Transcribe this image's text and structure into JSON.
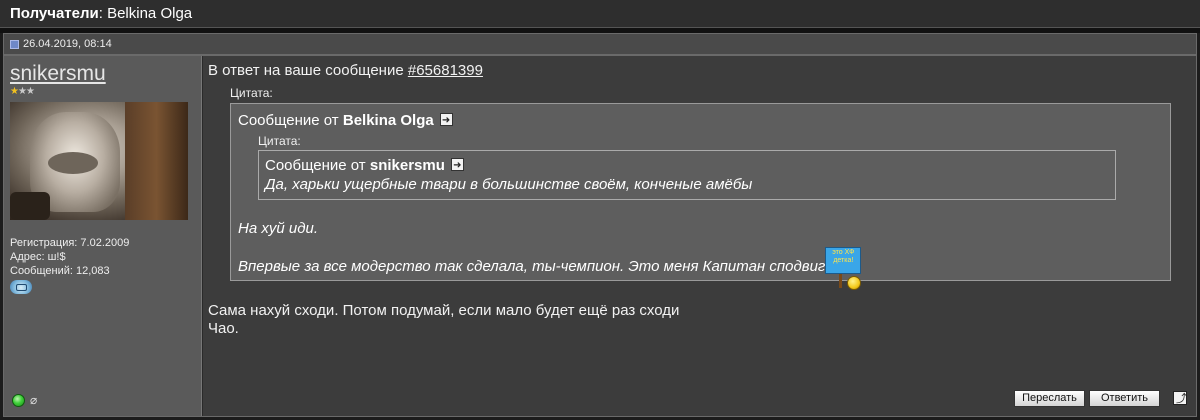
{
  "header": {
    "recipients_label": "Получатели",
    "recipients_sep": ": ",
    "recipients_value": "Belkina Olga"
  },
  "post": {
    "date": "26.04.2019, 08:14"
  },
  "user": {
    "name": "snikersmu",
    "stars": {
      "filled": 1,
      "total": 3
    },
    "registration": "Регистрация: 7.02.2009",
    "address": "Адрес: ш!$",
    "messages": "Сообщений: 12,083",
    "icons": [
      "im-icon",
      "online-status-icon",
      "attachment-icon"
    ]
  },
  "message": {
    "reply_prefix": "В ответ на ваше сообщение ",
    "reply_link": "#65681399",
    "quote_outer": {
      "label": "Цитата:",
      "from_prefix": "Сообщение от ",
      "author": "Belkina Olga",
      "inner_quote": {
        "label": "Цитата:",
        "from_prefix": "Сообщение от ",
        "author": "snikersmu",
        "text": "Да, харьки ущербные твари в большинстве своём, конченые амёбы"
      },
      "text1": "На хуй иди.",
      "text2": "Впервые за все модерство так сделала, ты-чемпион. Это меня Капитан сподвиг",
      "smiley_sign_text": "это ХФ детка!"
    },
    "body_line1": "Сама нахуй сходи. Потом подумай, если мало будет ещё раз сходи",
    "body_line2": "Чао."
  },
  "buttons": {
    "forward": "Переслать",
    "reply": "Ответить"
  },
  "colors": {
    "page_bg": "#1c1c1c",
    "panel_bg": "#5a5a5a",
    "content_bg": "#3c3c3c",
    "quote_bg": "#5e5e5e"
  }
}
